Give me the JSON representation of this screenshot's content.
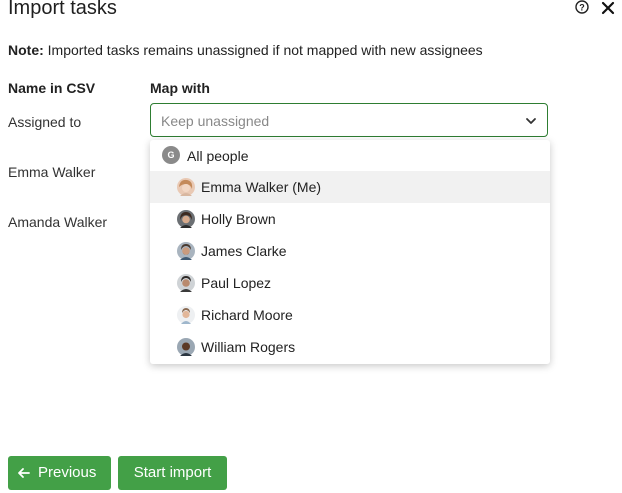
{
  "header": {
    "title": "Import tasks",
    "help_icon": "question-circle-icon",
    "close_icon": "close-icon"
  },
  "note": {
    "prefix": "Note:",
    "text": " Imported tasks remains unassigned if not mapped with new assignees"
  },
  "columns": {
    "name_in_csv": "Name in CSV",
    "map_with": "Map with"
  },
  "rows": [
    {
      "label": "Assigned to"
    },
    {
      "label": "Emma Walker"
    },
    {
      "label": "Amanda Walker"
    }
  ],
  "select": {
    "placeholder": "Keep unassigned",
    "icon": "chevron-down-icon",
    "border_color": "#2e7d32"
  },
  "dropdown": {
    "group": {
      "badge": "G",
      "label": "All people"
    },
    "options": [
      {
        "label": "Emma Walker (Me)",
        "icon": "avatar-emma",
        "highlighted": true
      },
      {
        "label": "Holly Brown",
        "icon": "avatar-holly",
        "highlighted": false
      },
      {
        "label": "James Clarke",
        "icon": "avatar-james",
        "highlighted": false
      },
      {
        "label": "Paul Lopez",
        "icon": "avatar-paul",
        "highlighted": false
      },
      {
        "label": "Richard Moore",
        "icon": "avatar-richard",
        "highlighted": false
      },
      {
        "label": "William Rogers",
        "icon": "avatar-william",
        "highlighted": false
      }
    ]
  },
  "footer": {
    "previous_label": "Previous",
    "start_label": "Start import",
    "button_color": "#43a047"
  }
}
